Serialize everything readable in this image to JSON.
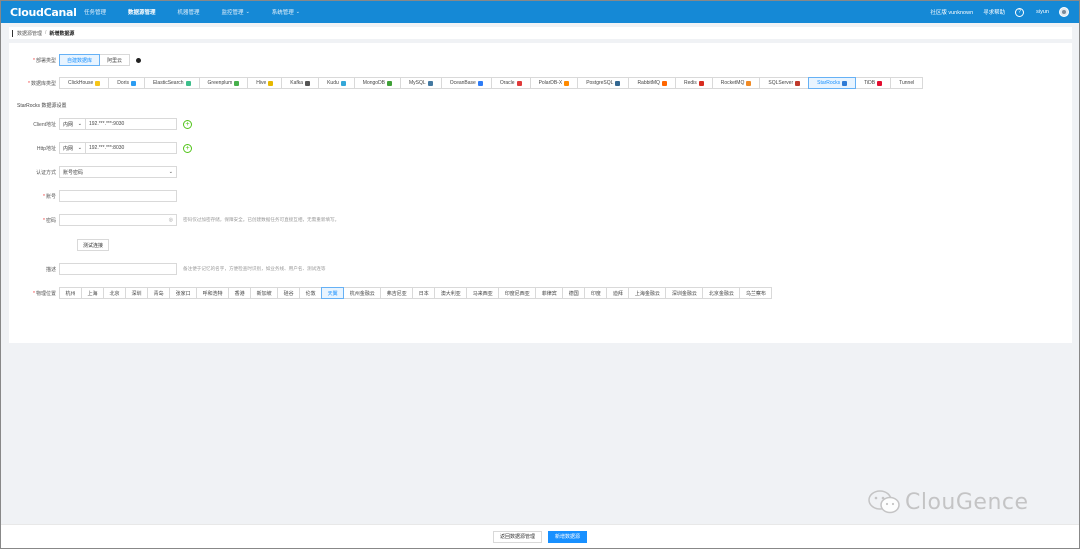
{
  "app": {
    "logo": "CloudCanal"
  },
  "nav": {
    "items": [
      {
        "label": "任务管理",
        "dropdown": false,
        "active": false
      },
      {
        "label": "数据源管理",
        "dropdown": false,
        "active": true
      },
      {
        "label": "机器管理",
        "dropdown": false,
        "active": false
      },
      {
        "label": "监控管理",
        "dropdown": true,
        "active": false
      },
      {
        "label": "系统管理",
        "dropdown": true,
        "active": false
      }
    ],
    "edition": "社区版 vunknown",
    "help_link": "寻求帮助",
    "help_icon": "?",
    "username": "siyun"
  },
  "breadcrumb": {
    "parent": "数据源管理",
    "separator": "/",
    "current": "新增数据源"
  },
  "form": {
    "deploy_type": {
      "label": "部署类型",
      "options": [
        "自建数据库",
        "阿里云"
      ],
      "selected": "自建数据库"
    },
    "db_type": {
      "label": "数据库类型",
      "selected": "StarRocks",
      "options": [
        {
          "label": "ClickHouse",
          "icon": "clickhouse-icon",
          "color": "#f5c518"
        },
        {
          "label": "Doris",
          "icon": "doris-icon",
          "color": "#2b9cf2"
        },
        {
          "label": "ElasticSearch",
          "icon": "elasticsearch-icon",
          "color": "#3dbe8b"
        },
        {
          "label": "Greenplum",
          "icon": "greenplum-icon",
          "color": "#47b04b"
        },
        {
          "label": "Hive",
          "icon": "hive-icon",
          "color": "#e6b800"
        },
        {
          "label": "Kafka",
          "icon": "kafka-icon",
          "color": "#555555"
        },
        {
          "label": "Kudu",
          "icon": "kudu-icon",
          "color": "#34a7d8"
        },
        {
          "label": "MongoDB",
          "icon": "mongodb-icon",
          "color": "#3fa037"
        },
        {
          "label": "MySQL",
          "icon": "mysql-icon",
          "color": "#4479a1"
        },
        {
          "label": "OceanBase",
          "icon": "oceanbase-icon",
          "color": "#2e7cf6"
        },
        {
          "label": "Oracle",
          "icon": "oracle-icon",
          "color": "#e03a3a"
        },
        {
          "label": "PolarDB-X",
          "icon": "polardbx-icon",
          "color": "#ff8a00"
        },
        {
          "label": "PostgreSQL",
          "icon": "postgresql-icon",
          "color": "#336791"
        },
        {
          "label": "RabbitMQ",
          "icon": "rabbitmq-icon",
          "color": "#ff6600"
        },
        {
          "label": "Redis",
          "icon": "redis-icon",
          "color": "#d82c20"
        },
        {
          "label": "RocketMQ",
          "icon": "rocketmq-icon",
          "color": "#f08a24"
        },
        {
          "label": "SQLServer",
          "icon": "sqlserver-icon",
          "color": "#c0392b"
        },
        {
          "label": "StarRocks",
          "icon": "starrocks-icon",
          "color": "#2d7bd6"
        },
        {
          "label": "TiDB",
          "icon": "tidb-icon",
          "color": "#e30c2f"
        },
        {
          "label": "Tunnel",
          "icon": "",
          "color": ""
        }
      ]
    },
    "section_title": "StarRocks 数据源设置",
    "client_addr": {
      "label": "Client地址",
      "network": "内网",
      "value": "192.***.***:9030"
    },
    "http_addr": {
      "label": "Http地址",
      "network": "内网",
      "value": "192.***.***:8030"
    },
    "auth": {
      "label": "认证方式",
      "value": "账号密码"
    },
    "account": {
      "label": "账号",
      "value": ""
    },
    "password": {
      "label": "密码",
      "value": "",
      "hint": "密码仅过加密存储，保障安全。已创建数据任务可直接互相，无需重新填写。"
    },
    "test_button": "测试连接",
    "description": {
      "label": "描述",
      "value": "",
      "hint": "备注便于记忆的名字，方便检查时识别，如业务线、用户名、测试连等"
    },
    "region": {
      "label": "物理位置",
      "selected": "天翼",
      "options": [
        "杭州",
        "上海",
        "北京",
        "深圳",
        "青岛",
        "张家口",
        "呼和浩特",
        "香港",
        "新加坡",
        "硅谷",
        "伦敦",
        "天翼",
        "杭州金融云",
        "弗吉尼亚",
        "日本",
        "澳大利亚",
        "马来西亚",
        "印度尼西亚",
        "菲律宾",
        "德国",
        "印度",
        "迪拜",
        "上海金融云",
        "深圳金融云",
        "北京金融云",
        "乌兰察布"
      ]
    }
  },
  "footer": {
    "back_button": "返回数据源管理",
    "submit_button": "新增数据源"
  },
  "watermark": {
    "text": "ClouGence"
  }
}
